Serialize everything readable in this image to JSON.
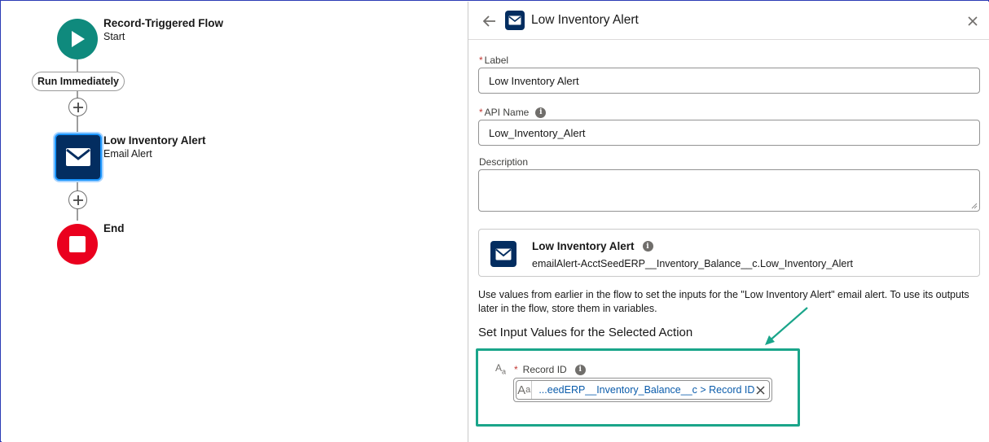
{
  "canvas": {
    "start_node": {
      "title": "Record-Triggered Flow",
      "subtitle": "Start"
    },
    "run_pill": "Run Immediately",
    "action_node": {
      "title": "Low Inventory Alert",
      "subtitle": "Email Alert"
    },
    "end_node": {
      "title": "End"
    }
  },
  "panel": {
    "header_title": "Low Inventory Alert",
    "label_field": {
      "required_mark": "*",
      "label": "Label",
      "value": "Low Inventory Alert"
    },
    "api_name_field": {
      "required_mark": "*",
      "label": "API Name",
      "value": "Low_Inventory_Alert"
    },
    "description_field": {
      "label": "Description",
      "value": ""
    },
    "action_card": {
      "title": "Low Inventory Alert",
      "subtitle": "emailAlert-AcctSeedERP__Inventory_Balance__c.Low_Inventory_Alert"
    },
    "help_text": "Use values from earlier in the flow to set the inputs for the \"Low Inventory Alert\" email alert. To use its outputs later in the flow, store them in variables.",
    "section_title": "Set Input Values for the Selected Action",
    "record_id": {
      "required_mark": "*",
      "label": "Record ID",
      "value": "...eedERP__Inventory_Balance__c > Record ID"
    }
  },
  "colors": {
    "start": "#0f8a7d",
    "action": "#032d60",
    "end": "#ea001e",
    "highlight": "#1aa58a",
    "link": "#0b5cab"
  },
  "icons": {
    "start": "play-icon",
    "action": "email-icon",
    "end": "stop-icon",
    "add": "plus-icon",
    "back": "arrow-left-icon",
    "close": "close-icon",
    "info": "info-icon",
    "text_type": "text-type-icon"
  }
}
